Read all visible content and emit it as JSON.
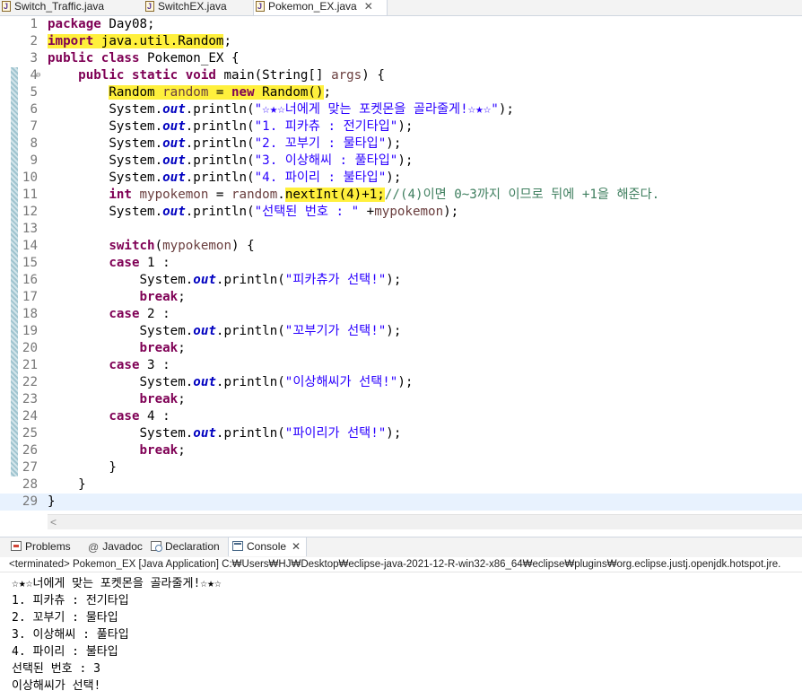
{
  "editor_tabs": [
    {
      "label": "Switch_Traffic.java",
      "active": false
    },
    {
      "label": "SwitchEX.java",
      "active": false
    },
    {
      "label": "Pokemon_EX.java",
      "active": true
    }
  ],
  "tab_close_glyph": "✕",
  "code_lines": [
    {
      "n": "1",
      "html": "<span class=\"kw\">package</span> Day08;"
    },
    {
      "n": "2",
      "html": "<span class=\"hl\"><span class=\"kw\">import</span> java.util.Random</span>;"
    },
    {
      "n": "3",
      "html": "<span class=\"kw\">public</span> <span class=\"kw\">class</span> Pokemon_EX {"
    },
    {
      "n": "4",
      "fold": "⊖",
      "html": "    <span class=\"kw\">public</span> <span class=\"kw\">static</span> <span class=\"kw\">void</span> main(String[] <span class=\"var\">args</span>) {"
    },
    {
      "n": "5",
      "html": "        <span class=\"hl\">Random <span class=\"var\">random</span> = <span class=\"kw\">new</span> Random()</span>;"
    },
    {
      "n": "6",
      "html": "        System.<span class=\"fld\">out</span>.println(<span class=\"str\">\"☆★☆너에게 맞는 포켓몬을 골라줄게!☆★☆\"</span>);"
    },
    {
      "n": "7",
      "html": "        System.<span class=\"fld\">out</span>.println(<span class=\"str\">\"1. 피카츄 : 전기타입\"</span>);"
    },
    {
      "n": "8",
      "html": "        System.<span class=\"fld\">out</span>.println(<span class=\"str\">\"2. 꼬부기 : 물타입\"</span>);"
    },
    {
      "n": "9",
      "html": "        System.<span class=\"fld\">out</span>.println(<span class=\"str\">\"3. 이상해씨 : 풀타입\"</span>);"
    },
    {
      "n": "10",
      "html": "        System.<span class=\"fld\">out</span>.println(<span class=\"str\">\"4. 파이리 : 불타입\"</span>);"
    },
    {
      "n": "11",
      "html": "        <span class=\"kw\">int</span> <span class=\"var\">mypokemon</span> = <span class=\"var\">random</span>.<span class=\"hl\">nextInt(4)+1;</span><span class=\"cmt\">//(4)이면 0~3까지 이므로 뒤에 +1을 해준다.</span>"
    },
    {
      "n": "12",
      "html": "        System.<span class=\"fld\">out</span>.println(<span class=\"str\">\"선택된 번호 : \"</span> +<span class=\"var\">mypokemon</span>);"
    },
    {
      "n": "13",
      "html": ""
    },
    {
      "n": "14",
      "html": "        <span class=\"kw\">switch</span>(<span class=\"var\">mypokemon</span>) {"
    },
    {
      "n": "15",
      "html": "        <span class=\"kw\">case</span> 1 :"
    },
    {
      "n": "16",
      "html": "            System.<span class=\"fld\">out</span>.println(<span class=\"str\">\"피카츄가 선택!\"</span>);"
    },
    {
      "n": "17",
      "html": "            <span class=\"kw\">break</span>;"
    },
    {
      "n": "18",
      "html": "        <span class=\"kw\">case</span> 2 :"
    },
    {
      "n": "19",
      "html": "            System.<span class=\"fld\">out</span>.println(<span class=\"str\">\"꼬부기가 선택!\"</span>);"
    },
    {
      "n": "20",
      "html": "            <span class=\"kw\">break</span>;"
    },
    {
      "n": "21",
      "html": "        <span class=\"kw\">case</span> 3 :"
    },
    {
      "n": "22",
      "html": "            System.<span class=\"fld\">out</span>.println(<span class=\"str\">\"이상해씨가 선택!\"</span>);"
    },
    {
      "n": "23",
      "html": "            <span class=\"kw\">break</span>;"
    },
    {
      "n": "24",
      "html": "        <span class=\"kw\">case</span> 4 :"
    },
    {
      "n": "25",
      "html": "            System.<span class=\"fld\">out</span>.println(<span class=\"str\">\"파이리가 선택!\"</span>);"
    },
    {
      "n": "26",
      "html": "            <span class=\"kw\">break</span>;"
    },
    {
      "n": "27",
      "html": "        }"
    },
    {
      "n": "28",
      "html": "    }"
    },
    {
      "n": "29",
      "html": "}",
      "current": true
    }
  ],
  "view_tabs": [
    {
      "label": "Problems",
      "icon": "problems-icon",
      "active": false
    },
    {
      "label": "Javadoc",
      "icon": "javadoc-icon",
      "active": false
    },
    {
      "label": "Declaration",
      "icon": "declaration-icon",
      "active": false
    },
    {
      "label": "Console",
      "icon": "console-icon",
      "active": true
    }
  ],
  "javadoc_glyph": "@",
  "scroll_left_glyph": "<",
  "console_process": "<terminated> Pokemon_EX [Java Application] C:₩Users₩HJ₩Desktop₩eclipse-java-2021-12-R-win32-x86_64₩eclipse₩plugins₩org.eclipse.justj.openjdk.hotspot.jre.",
  "console_output": [
    "☆★☆너에게 맞는 포켓몬을 골라줄게!☆★☆",
    "1. 피카츄 : 전기타입",
    "2. 꼬부기 : 물타입",
    "3. 이상해씨 : 풀타입",
    "4. 파이리 : 불타입",
    "선택된 번호 : 3",
    "이상해씨가 선택!"
  ],
  "colors": {
    "keyword": "#7f0055",
    "string": "#2a00ff",
    "comment": "#3f7f5f",
    "field": "#0000c0",
    "highlight": "#fff03c",
    "current_line": "#e8f2fe"
  }
}
